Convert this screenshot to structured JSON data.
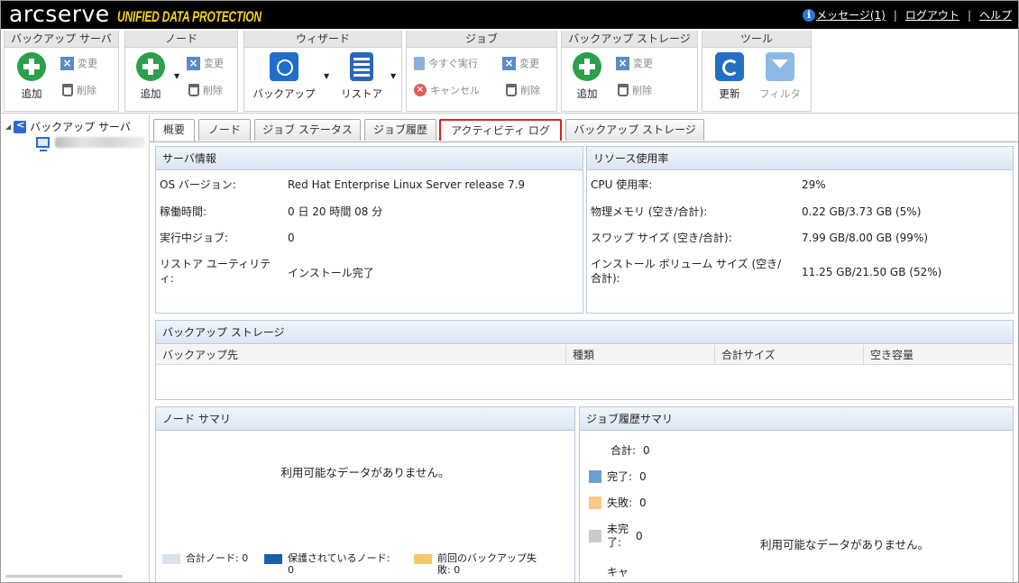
{
  "brand": {
    "name": "arcserve",
    "product": "UNIFIED DATA PROTECTION"
  },
  "top_links": {
    "messages": "メッセージ(1)",
    "logout": "ログアウト",
    "help": "ヘルプ"
  },
  "ribbon": {
    "backup_server": {
      "title": "バックアップ サーバ",
      "add": "追加",
      "modify": "変更",
      "delete": "削除"
    },
    "node": {
      "title": "ノード",
      "add": "追加",
      "modify": "変更",
      "delete": "削除"
    },
    "wizard": {
      "title": "ウィザード",
      "backup": "バックアップ",
      "restore": "リストア"
    },
    "job": {
      "title": "ジョブ",
      "run_now": "今すぐ実行",
      "modify": "変更",
      "cancel": "キャンセル",
      "delete": "削除"
    },
    "backup_storage": {
      "title": "バックアップ ストレージ",
      "add": "追加",
      "modify": "変更",
      "delete": "削除"
    },
    "tools": {
      "title": "ツール",
      "refresh": "更新",
      "filter": "フィルタ"
    }
  },
  "tree": {
    "root_label": "バックアップ サーバ"
  },
  "tabs": [
    "概要",
    "ノード",
    "ジョブ ステータス",
    "ジョブ履歴",
    "アクティビティ ログ",
    "バックアップ ストレージ"
  ],
  "server_info": {
    "title": "サーバ情報",
    "rows": [
      {
        "label": "OS バージョン:",
        "value": "Red Hat Enterprise Linux Server release 7.9"
      },
      {
        "label": "稼働時間:",
        "value": "0 日 20 時間 08 分"
      },
      {
        "label": "実行中ジョブ:",
        "value": "0"
      },
      {
        "label": "リストア ユーティリティ:",
        "value": "インストール完了"
      }
    ]
  },
  "resource_usage": {
    "title": "リソース使用率",
    "rows": [
      {
        "label": "CPU 使用率:",
        "value": "29%"
      },
      {
        "label": "物理メモリ (空き/合計):",
        "value": "0.22 GB/3.73 GB (5%)"
      },
      {
        "label": "スワップ サイズ (空き/合計):",
        "value": "7.99 GB/8.00 GB (99%)"
      },
      {
        "label": "インストール ボリューム サイズ (空き/合計):",
        "value": "11.25 GB/21.50 GB (52%)"
      }
    ]
  },
  "backup_storage_panel": {
    "title": "バックアップ ストレージ",
    "columns": [
      "バックアップ先",
      "種類",
      "合計サイズ",
      "空き容量"
    ]
  },
  "node_summary": {
    "title": "ノード サマリ",
    "no_data": "利用可能なデータがありません。",
    "legend": [
      {
        "label": "合計ノード: 0",
        "color": "#d8e2ee"
      },
      {
        "label": "保護されているノード: 0",
        "color": "#1b5fa8"
      },
      {
        "label": "前回のバックアップ失敗: 0",
        "color": "#f7c86a"
      }
    ]
  },
  "job_history_summary": {
    "title": "ジョブ履歴サマリ",
    "no_data": "利用可能なデータがありません。",
    "total": "合計:",
    "total_value": "0",
    "items": [
      {
        "label": "完了:",
        "value": "0",
        "color": "#6a9fd4"
      },
      {
        "label": "失敗:",
        "value": "0",
        "color": "#f9c884"
      },
      {
        "label": "未完了:",
        "value": "0",
        "color": "#c8cccc"
      },
      {
        "label": "キャ",
        "value": "",
        "color": ""
      }
    ]
  }
}
